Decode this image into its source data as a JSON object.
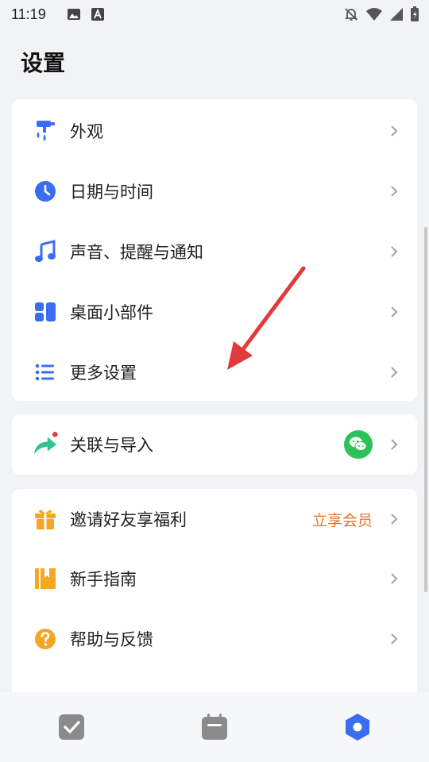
{
  "status_bar": {
    "time": "11:19"
  },
  "page": {
    "title": "设置"
  },
  "settings_group": [
    {
      "key": "appearance",
      "label": "外观",
      "icon": "paint-roller-icon"
    },
    {
      "key": "datetime",
      "label": "日期与时间",
      "icon": "clock-icon"
    },
    {
      "key": "sound",
      "label": "声音、提醒与通知",
      "icon": "music-note-icon"
    },
    {
      "key": "widgets",
      "label": "桌面小部件",
      "icon": "widgets-icon"
    },
    {
      "key": "more",
      "label": "更多设置",
      "icon": "list-settings-icon"
    }
  ],
  "link_group": [
    {
      "key": "link-import",
      "label": "关联与导入",
      "icon": "share-arrow-icon",
      "badge_icon": "wechat-icon"
    }
  ],
  "misc_group": [
    {
      "key": "invite",
      "label": "邀请好友享福利",
      "icon": "gift-icon",
      "extra": "立享会员"
    },
    {
      "key": "guide",
      "label": "新手指南",
      "icon": "book-icon"
    },
    {
      "key": "help",
      "label": "帮助与反馈",
      "icon": "question-icon"
    }
  ],
  "colors": {
    "accent_blue": "#3a6df0",
    "accent_orange": "#f5a623",
    "wechat_green": "#2dc159",
    "promo_text": "#e5762c",
    "arrow_red": "#e03a3a"
  },
  "bottom_nav": [
    {
      "key": "tasks",
      "icon": "checkbox-icon"
    },
    {
      "key": "calendar",
      "icon": "calendar-icon"
    },
    {
      "key": "settings",
      "icon": "hexagon-settings-icon"
    }
  ]
}
